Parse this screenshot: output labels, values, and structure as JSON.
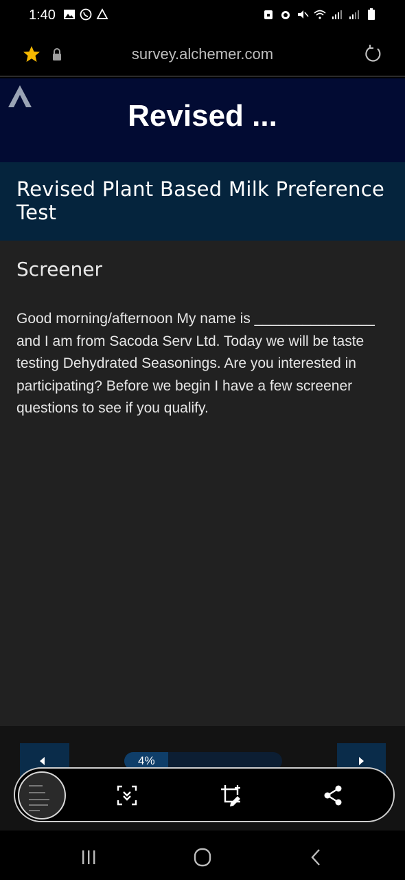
{
  "status_bar": {
    "time": "1:40",
    "left_icons": [
      "image-icon",
      "whatsapp-icon",
      "drive-icon"
    ],
    "right_icons": [
      "alarm-lock-icon",
      "alarm-icon",
      "mute-icon",
      "wifi-icon",
      "signal-icon",
      "signal-icon",
      "battery-icon"
    ]
  },
  "url_bar": {
    "url": "survey.alchemer.com",
    "star_color": "#f5b800"
  },
  "survey_header": {
    "title": "Revised ..."
  },
  "survey": {
    "title": "Revised Plant Based Milk Preference Test",
    "page_heading": "Screener",
    "intro_text": "Good morning/afternoon My name is _______________ and I am from Sacoda Serv Ltd. Today we will be taste testing Dehydrated Seasonings. Are you interested in participating? Before we begin I have a few screener questions to see if you qualify."
  },
  "navigation": {
    "progress_label": "4%",
    "progress_fraction": 0.04
  },
  "capture_toolbar": {
    "icons": [
      "scroll-capture-icon",
      "crop-edit-icon",
      "share-icon"
    ]
  },
  "android_nav": {
    "icons": [
      "recents-icon",
      "home-icon",
      "back-icon"
    ]
  },
  "colors": {
    "header_bg": "#020b33",
    "title_band_bg": "#05243d",
    "content_bg": "#212121",
    "nav_button_bg": "#0a2c4a"
  }
}
